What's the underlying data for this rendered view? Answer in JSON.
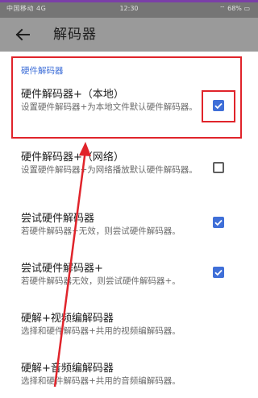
{
  "status_bar": {
    "left_text": "中国移动 4G",
    "time": "12:30",
    "battery": "68%"
  },
  "toolbar": {
    "title": "解码器"
  },
  "section": {
    "header": "硬件解码器"
  },
  "items": [
    {
      "title": "硬件解码器+（本地）",
      "desc": "设置硬件解码器+为本地文件默认硬件解码器。",
      "checked": true
    },
    {
      "title": "硬件解码器+（网络）",
      "desc": "设置硬件解码器+为网络播放默认硬件解码器。",
      "checked": false
    },
    {
      "title": "尝试硬件解码器",
      "desc": "若硬件解码器+无效，则尝试硬件解码器。",
      "checked": true
    },
    {
      "title": "尝试硬件解码器+",
      "desc": "若硬件解码器无效，则尝试硬件解码器+。",
      "checked": true
    },
    {
      "title": "硬解+视频编解码器",
      "desc": "选择和硬件解码器+共用的视频编解码器。"
    },
    {
      "title": "硬解+音频编解码器",
      "desc": "选择和硬件解码器+共用的音频编解码器。"
    }
  ],
  "colors": {
    "accent": "#3f6fd8",
    "annotation": "#e0242b",
    "toolbar": "#9a9a9a"
  }
}
